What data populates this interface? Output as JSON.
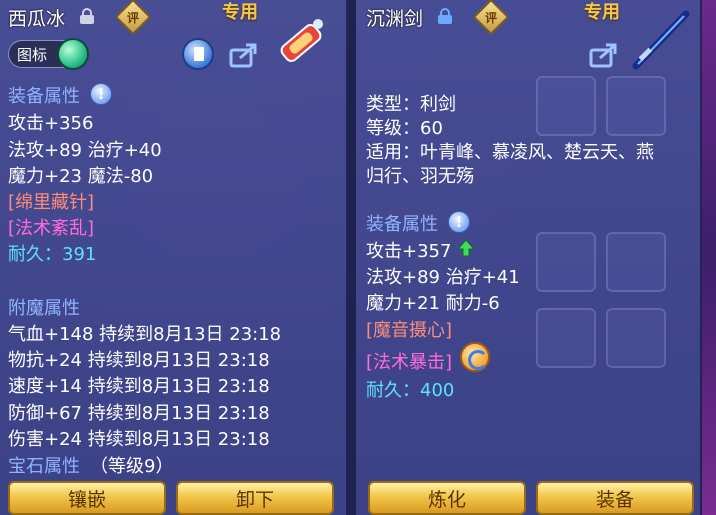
{
  "left": {
    "item_name": "西瓜冰",
    "rate_label": "评",
    "exclusive_label": "专用",
    "toggle_label": "图标",
    "equip_section": "装备属性",
    "stats": [
      "攻击+356",
      "法攻+89 治疗+40",
      "魔力+23 魔法-80"
    ],
    "specials": [
      "[绵里藏针]",
      "[法术紊乱]"
    ],
    "durability": "耐久：391",
    "enchant_section": "附魔属性",
    "enchant_stats": [
      "气血+148 持续到8月13日 23:18",
      "物抗+24 持续到8月13日 23:18",
      "速度+14 持续到8月13日 23:18",
      "防御+67 持续到8月13日 23:18",
      "伤害+24 持续到8月13日 23:18"
    ],
    "gem_section": "宝石属性",
    "gem_level": "（等级9）",
    "buttons": [
      "镶嵌",
      "卸下"
    ]
  },
  "right": {
    "item_name": "沉渊剑",
    "rate_label": "评",
    "exclusive_label": "专用",
    "type_line": "类型：利剑",
    "level_line": "等级：60",
    "use_line1": "适用：叶青峰、慕凌风、楚云天、燕",
    "use_line2": "归行、羽无殇",
    "equip_section": "装备属性",
    "stats": [
      "攻击+357",
      "法攻+89 治疗+41",
      "魔力+21 耐力-6"
    ],
    "specials": [
      "[魔音摄心]",
      "[法术暴击]"
    ],
    "durability": "耐久：400",
    "buttons": [
      "炼化",
      "装备"
    ]
  },
  "info_mark": "!",
  "colors": {
    "section": "#8fb4ff",
    "special_red": "#ff8c7a",
    "special_pink": "#ff6cd9",
    "durability": "#5ee0ff",
    "exclusive": "#f5c84a"
  }
}
